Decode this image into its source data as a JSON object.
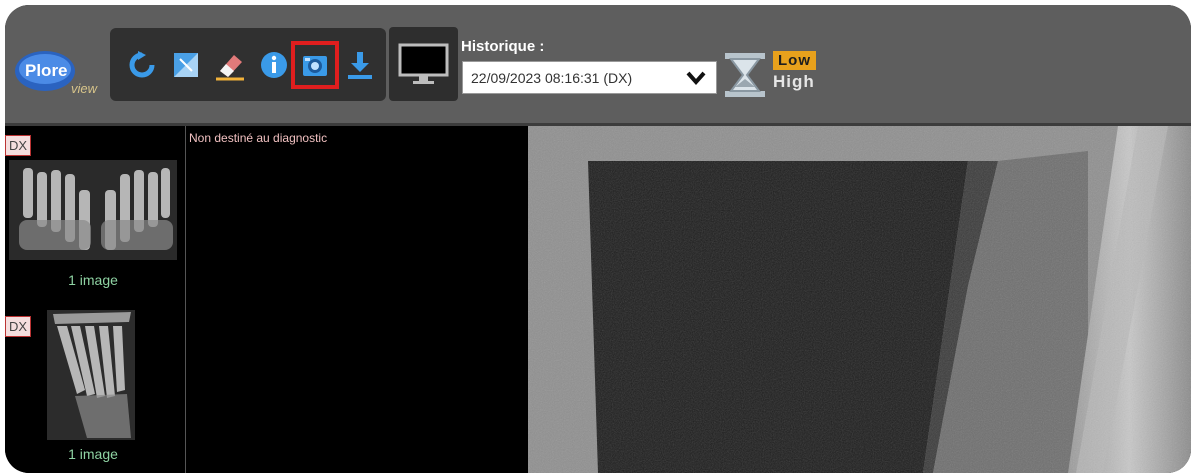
{
  "app": {
    "logo_text": "Plore",
    "logo_sub": "view"
  },
  "toolbar": {
    "tools": [
      {
        "name": "rotate-icon"
      },
      {
        "name": "invert-icon"
      },
      {
        "name": "eraser-icon"
      },
      {
        "name": "info-icon"
      },
      {
        "name": "camera-icon",
        "selected": true
      },
      {
        "name": "download-icon"
      }
    ],
    "monitor_icon": "monitor-icon",
    "history_label": "Historique :",
    "history_value": "22/09/2023 08:16:31 (DX)",
    "quality_low": "Low",
    "quality_high": "High",
    "colors": {
      "accent": "#e01e1e",
      "low_badge": "#e8a11c",
      "toolbar_bg": "#5e5e5e"
    }
  },
  "studies": [
    {
      "modality": "DX",
      "count_label": "1 image"
    },
    {
      "modality": "DX",
      "count_label": "1 image"
    }
  ],
  "viewer": {
    "disclaimer": "Non destiné au diagnostic"
  }
}
